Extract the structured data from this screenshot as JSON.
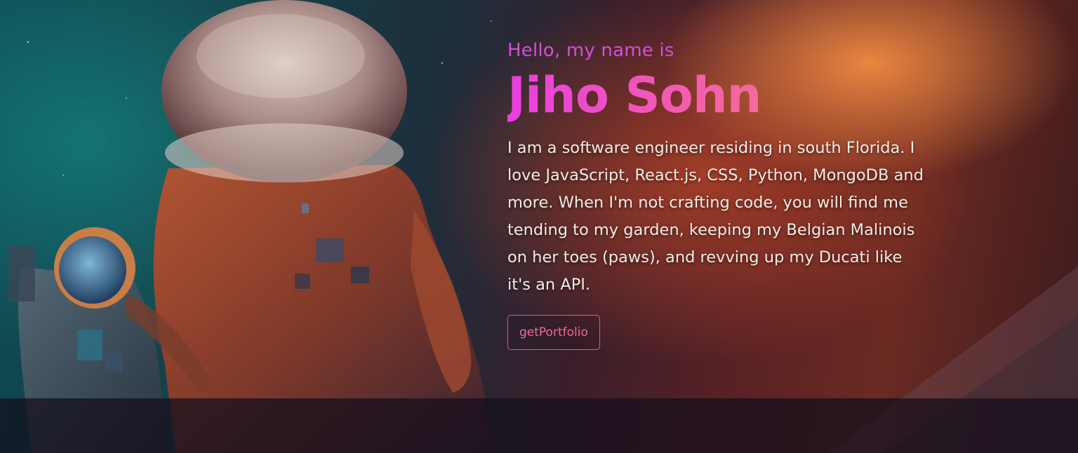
{
  "hero": {
    "greeting": "Hello, my name is",
    "name": "Jiho Sohn",
    "bio": "I am a software engineer residing in south Florida. I love JavaScript, React.js, CSS, Python, MongoDB and more. When I'm not crafting code, you will find me tending to my garden, keeping my Belgian Malinois on her toes (paws), and revving up my Ducati like it's an API.",
    "cta_label": "getPortfolio",
    "background_image": "astronauts-space-illustration"
  },
  "colors": {
    "accent_pink": "#e93ee0",
    "accent_coral": "#f5876e",
    "text_light": "#f3ece6"
  }
}
